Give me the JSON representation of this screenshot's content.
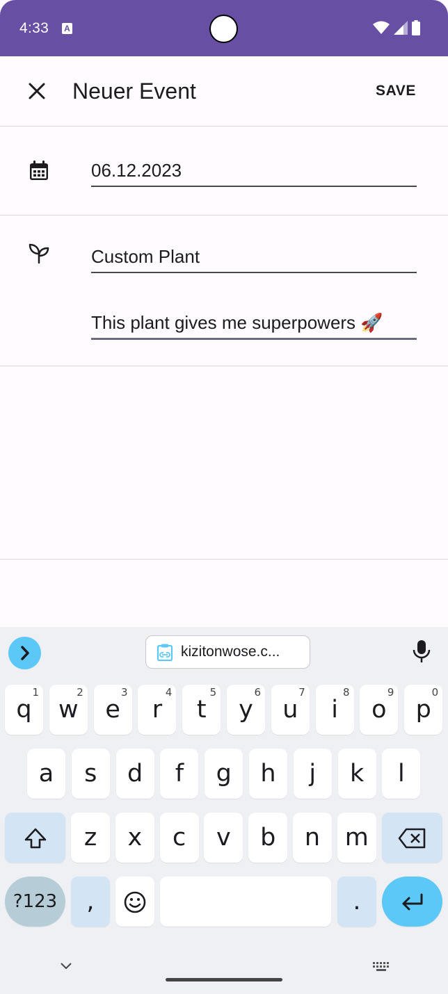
{
  "status": {
    "time": "4:33"
  },
  "appbar": {
    "title": "Neuer Event",
    "save_label": "SAVE"
  },
  "form": {
    "date": "06.12.2023",
    "plant_name": "Custom Plant",
    "description": "This plant gives me superpowers 🚀"
  },
  "keyboard": {
    "clipboard_text": "kizitonwose.c...",
    "row1": [
      {
        "k": "q",
        "h": "1"
      },
      {
        "k": "w",
        "h": "2"
      },
      {
        "k": "e",
        "h": "3"
      },
      {
        "k": "r",
        "h": "4"
      },
      {
        "k": "t",
        "h": "5"
      },
      {
        "k": "y",
        "h": "6"
      },
      {
        "k": "u",
        "h": "7"
      },
      {
        "k": "i",
        "h": "8"
      },
      {
        "k": "o",
        "h": "9"
      },
      {
        "k": "p",
        "h": "0"
      }
    ],
    "row2": [
      "a",
      "s",
      "d",
      "f",
      "g",
      "h",
      "j",
      "k",
      "l"
    ],
    "row3": [
      "z",
      "x",
      "c",
      "v",
      "b",
      "n",
      "m"
    ],
    "sym_label": "?123",
    "comma_label": ",",
    "period_label": ".",
    "accent_color": "#5cc8f8"
  }
}
